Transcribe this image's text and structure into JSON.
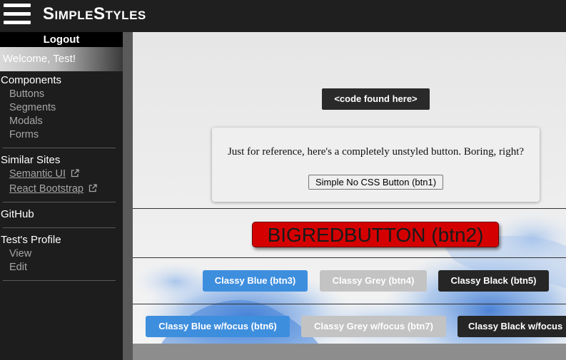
{
  "header": {
    "brand": "SimpleStyles"
  },
  "sidebar": {
    "logout": "Logout",
    "welcome": "Welcome, Test!",
    "components": {
      "heading": "Components",
      "items": [
        "Buttons",
        "Segments",
        "Modals",
        "Forms"
      ]
    },
    "similar_sites": {
      "heading": "Similar Sites",
      "items": [
        "Semantic UI",
        "React Bootstrap"
      ]
    },
    "github": "GitHub",
    "profile": {
      "heading": "Test's Profile",
      "items": [
        "View",
        "Edit"
      ]
    }
  },
  "main": {
    "code_button": "<code found here>",
    "card_text": "Just for reference, here's a completely unstyled button. Boring, right?",
    "plain_button": "Simple No CSS Button (btn1)",
    "big_red_button": "BIGREDBUTTON (btn2)",
    "classy_row": [
      "Classy Blue (btn3)",
      "Classy Grey (btn4)",
      "Classy Black (btn5)"
    ],
    "focus_row": [
      "Classy Blue w/focus (btn6)",
      "Classy Grey w/focus (btn7)",
      "Classy Black w/focus"
    ]
  },
  "colors": {
    "topbar": "#1f1f1f",
    "sidebar": "#1d1d1d",
    "classy_blue": "#3e8ede",
    "classy_grey": "#c3c3c3",
    "classy_black": "#262626",
    "big_red": "#d40000"
  },
  "icons": {
    "menu": "hamburger-menu-icon",
    "external": "external-link-icon"
  }
}
